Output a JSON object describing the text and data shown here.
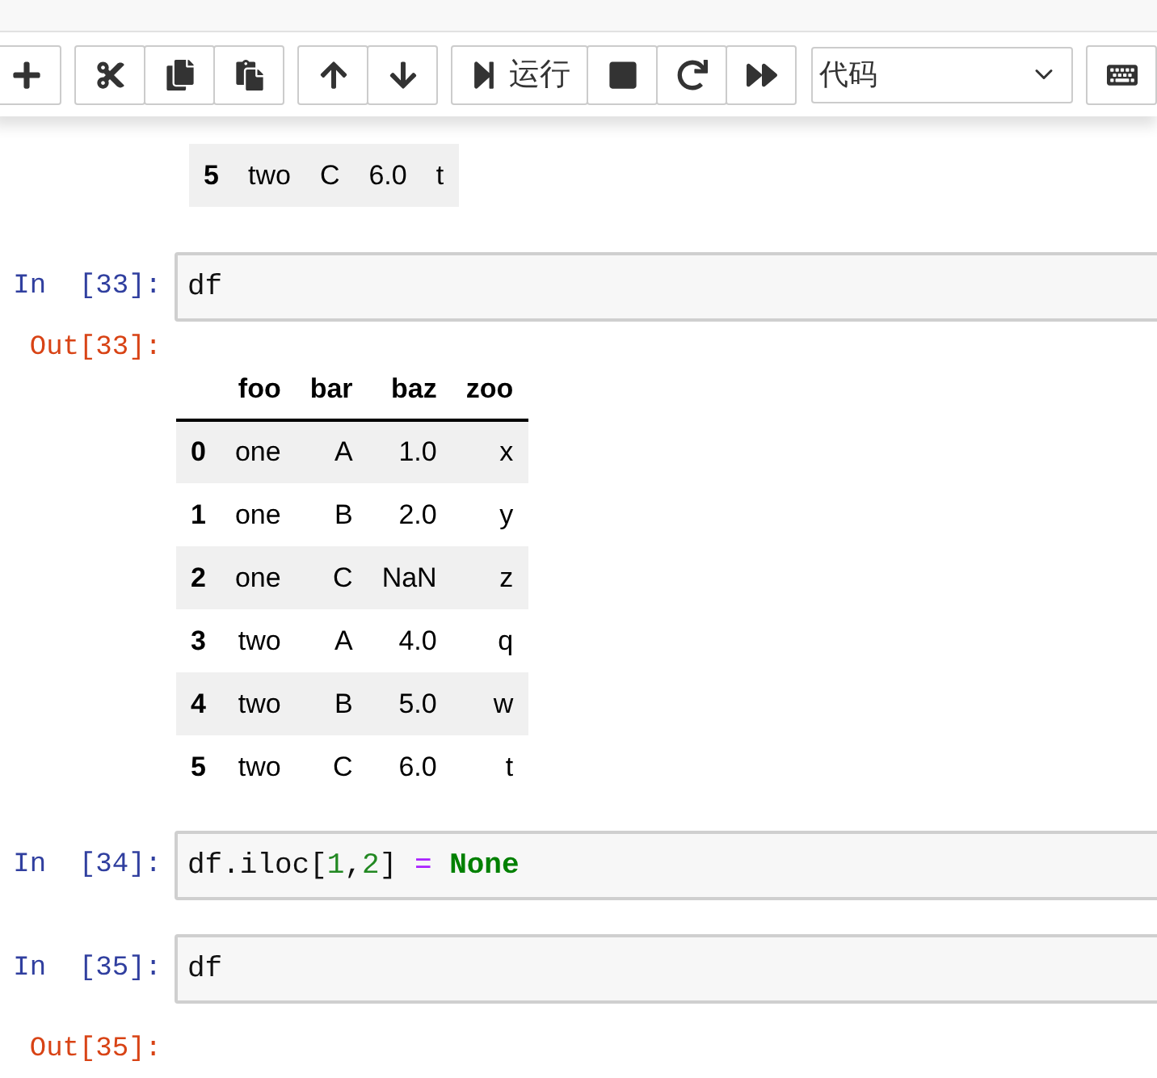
{
  "toolbar": {
    "groups": [
      {
        "buttons": [
          {
            "kind": "add"
          }
        ]
      },
      {
        "buttons": [
          {
            "kind": "cut"
          },
          {
            "kind": "copy"
          },
          {
            "kind": "paste"
          }
        ]
      },
      {
        "buttons": [
          {
            "kind": "move-up"
          },
          {
            "kind": "move-down"
          }
        ]
      },
      {
        "buttons": [
          {
            "kind": "run",
            "label": "运行"
          },
          {
            "kind": "stop"
          },
          {
            "kind": "restart"
          },
          {
            "kind": "run-all"
          }
        ]
      }
    ],
    "cell_type_select": {
      "value": "代码"
    },
    "extra_buttons": [
      {
        "kind": "keyboard"
      }
    ]
  },
  "cells": [
    {
      "kind": "output",
      "table": {
        "rows": [
          {
            "index": "5",
            "values": [
              "two",
              "C",
              "6.0",
              "t"
            ],
            "shaded": true
          }
        ]
      }
    },
    {
      "kind": "code",
      "prompt": "In  [33]:",
      "tokens": [
        {
          "kind": "name",
          "text": "df"
        }
      ]
    },
    {
      "kind": "output",
      "prompt": "Out[33]:",
      "table": {
        "columns": [
          "foo",
          "bar",
          "baz",
          "zoo"
        ],
        "rows": [
          {
            "index": "0",
            "values": [
              "one",
              "A",
              "1.0",
              "x"
            ],
            "shaded": true
          },
          {
            "index": "1",
            "values": [
              "one",
              "B",
              "2.0",
              "y"
            ],
            "shaded": false
          },
          {
            "index": "2",
            "values": [
              "one",
              "C",
              "NaN",
              "z"
            ],
            "shaded": true
          },
          {
            "index": "3",
            "values": [
              "two",
              "A",
              "4.0",
              "q"
            ],
            "shaded": false
          },
          {
            "index": "4",
            "values": [
              "two",
              "B",
              "5.0",
              "w"
            ],
            "shaded": true
          },
          {
            "index": "5",
            "values": [
              "two",
              "C",
              "6.0",
              "t"
            ],
            "shaded": false
          }
        ]
      }
    },
    {
      "kind": "code",
      "prompt": "In  [34]:",
      "tokens": [
        {
          "kind": "name",
          "text": "df.iloc["
        },
        {
          "kind": "number",
          "text": "1"
        },
        {
          "kind": "name",
          "text": ","
        },
        {
          "kind": "number",
          "text": "2"
        },
        {
          "kind": "name",
          "text": "]"
        },
        {
          "kind": "operator",
          "text": " = "
        },
        {
          "kind": "keyword",
          "text": "None"
        }
      ]
    },
    {
      "kind": "code",
      "prompt": "In  [35]:",
      "tokens": [
        {
          "kind": "name",
          "text": "df"
        }
      ]
    },
    {
      "kind": "output",
      "prompt": "Out[35]:"
    }
  ]
}
